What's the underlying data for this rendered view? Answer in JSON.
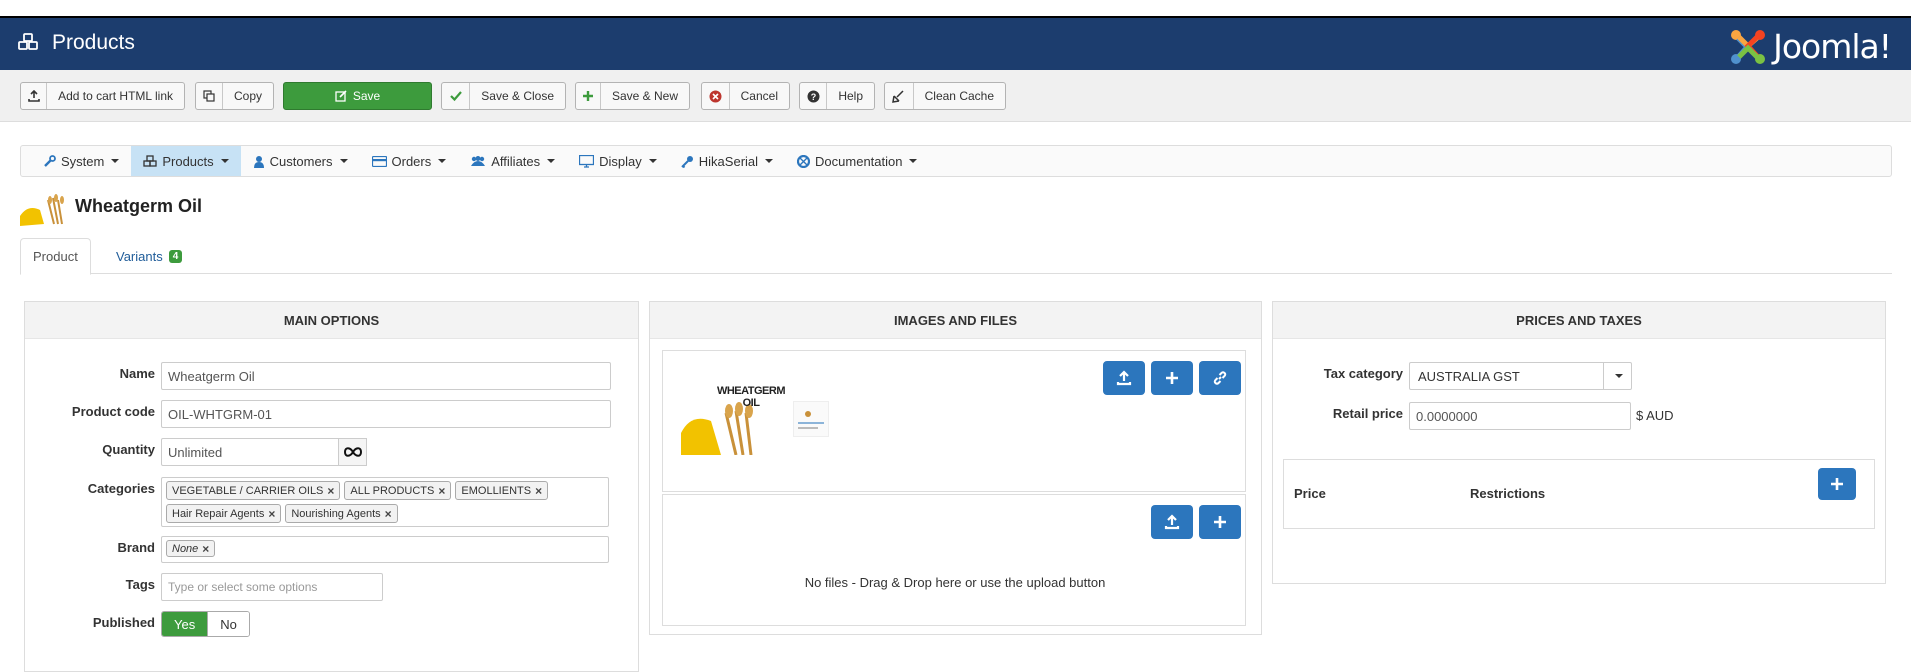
{
  "header": {
    "title": "Products",
    "brand": "Joomla!"
  },
  "toolbar": {
    "add_to_cart": "Add to cart HTML link",
    "copy": "Copy",
    "save": "Save",
    "save_close": "Save & Close",
    "save_new": "Save & New",
    "cancel": "Cancel",
    "help": "Help",
    "clean_cache": "Clean Cache"
  },
  "menu": {
    "items": [
      {
        "label": "System",
        "icon": "wrench-icon"
      },
      {
        "label": "Products",
        "icon": "cubes-icon",
        "active": true
      },
      {
        "label": "Customers",
        "icon": "user-icon"
      },
      {
        "label": "Orders",
        "icon": "credit-card-icon"
      },
      {
        "label": "Affiliates",
        "icon": "users-icon"
      },
      {
        "label": "Display",
        "icon": "monitor-icon"
      },
      {
        "label": "HikaSerial",
        "icon": "key-icon"
      },
      {
        "label": "Documentation",
        "icon": "lifebuoy-icon"
      }
    ]
  },
  "product": {
    "title": "Wheatgerm Oil",
    "thumb_text": "WHEATGERM OIL"
  },
  "tabs": {
    "product": "Product",
    "variants": "Variants",
    "variants_count": "4"
  },
  "main_options": {
    "heading": "MAIN OPTIONS",
    "name_label": "Name",
    "name_value": "Wheatgerm Oil",
    "code_label": "Product code",
    "code_value": "OIL-WHTGRM-01",
    "quantity_label": "Quantity",
    "quantity_value": "Unlimited",
    "categories_label": "Categories",
    "categories": [
      "VEGETABLE / CARRIER OILS",
      "ALL PRODUCTS",
      "EMOLLIENTS",
      "Hair Repair Agents",
      "Nourishing Agents"
    ],
    "brand_label": "Brand",
    "brand_value": "None",
    "tags_label": "Tags",
    "tags_placeholder": "Type or select some options",
    "published_label": "Published",
    "yes": "Yes",
    "no": "No"
  },
  "images_files": {
    "heading": "IMAGES AND FILES",
    "image_text": "WHEATGERM OIL",
    "no_files": "No files - Drag & Drop here or use the upload button"
  },
  "prices_taxes": {
    "heading": "PRICES AND TAXES",
    "tax_label": "Tax category",
    "tax_value": "AUSTRALIA GST",
    "retail_label": "Retail price",
    "retail_value": "0.0000000",
    "currency": "$ AUD",
    "col_price": "Price",
    "col_restrictions": "Restrictions"
  },
  "colors": {
    "header_bg": "#1c3d6e",
    "primary_blue": "#2c76bd",
    "success_green": "#3d9b3d"
  }
}
